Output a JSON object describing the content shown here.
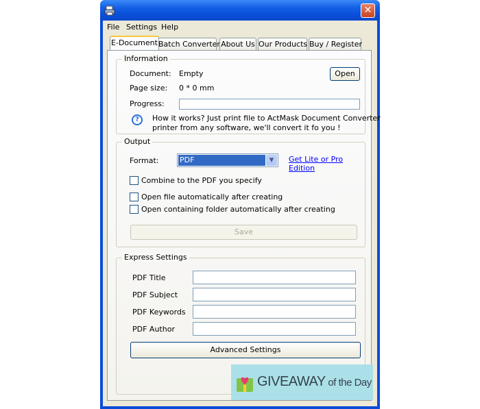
{
  "menu": {
    "file": "File",
    "settings": "Settings",
    "help": "Help"
  },
  "tabs": [
    "E-Document",
    "Batch Converter",
    "About Us",
    "Our Products",
    "Buy / Register"
  ],
  "information": {
    "legend": "Information",
    "document_label": "Document:",
    "document_value": "Empty",
    "page_size_label": "Page size:",
    "page_size_value": "0 * 0 mm",
    "progress_label": "Progress:",
    "progress": 0,
    "open_button": "Open",
    "help_line1": "How it works? Just print file to ActMask Document Converter",
    "help_line2": "printer from any software, we'll convert it fo you !"
  },
  "output": {
    "legend": "Output",
    "format_label": "Format:",
    "format_value": "PDF",
    "edition_link": "Get Lite or Pro Edition",
    "combine_label": "Combine to the PDF you specify",
    "combine_checked": false,
    "open_file_label": "Open file automatically after creating",
    "open_file_checked": false,
    "open_folder_label": "Open containing folder automatically after creating",
    "open_folder_checked": false,
    "save_button": "Save"
  },
  "express": {
    "legend": "Express Settings",
    "title_label": "PDF Title",
    "title_value": "",
    "subject_label": "PDF Subject",
    "subject_value": "",
    "keywords_label": "PDF Keywords",
    "keywords_value": "",
    "author_label": "PDF Author",
    "author_value": "",
    "advanced_button": "Advanced Settings"
  },
  "watermark": {
    "text_main": "GIVEAWAY",
    "text_small": " of the Day"
  },
  "colors": {
    "titlebar": "#0a4fd9",
    "face": "#ece9d8",
    "link": "#0000ff",
    "selection": "#316ac5"
  }
}
